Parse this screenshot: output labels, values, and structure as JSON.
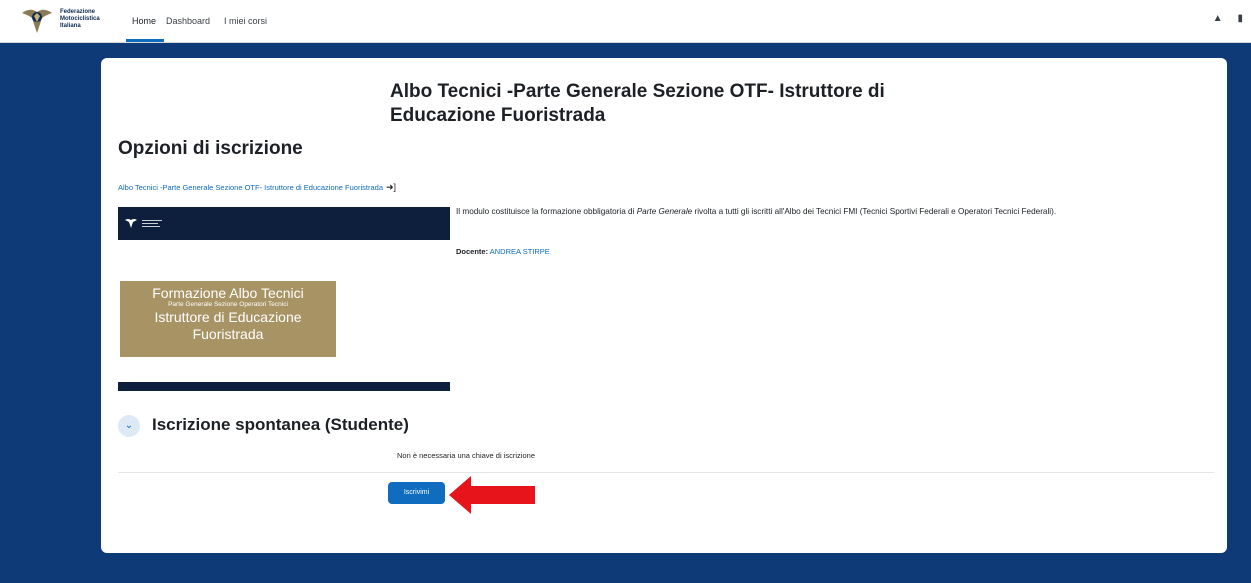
{
  "header": {
    "logo_text": [
      "Federazione",
      "Motociclistica",
      "Italiana"
    ],
    "nav": [
      {
        "label": "Home"
      },
      {
        "label": "Dashboard"
      },
      {
        "label": "I miei corsi"
      }
    ],
    "icons": [
      "bell-icon",
      "chat-icon"
    ]
  },
  "main": {
    "course_title_line1": "Albo Tecnici -Parte Generale Sezione OTF- Istruttore di",
    "course_title_line2": "Educazione Fuoristrada",
    "section_title": "Opzioni di iscrizione",
    "course_link": "Albo Tecnici -Parte Generale Sezione OTF- Istruttore di Educazione Fuoristrada",
    "summary_pre": "Il modulo costituisce la formazione obbligatoria di ",
    "summary_em": "Parte Generale",
    "summary_post": " rivolta a tutti gli iscritti all'Albo dei Tecnici FMI (Tecnici Sportivi Federali e Operatori Tecnici Federali).",
    "teacher_label": "Docente:",
    "teacher_name": "ANDREA STIRPE",
    "image": {
      "line1": "Formazione Albo Tecnici",
      "line2": "Parte Generale Sezione Operatori Tecnici",
      "line3": "Istruttore di Educazione",
      "line4": "Fuoristrada"
    },
    "enrol": {
      "title": "Iscrizione spontanea (Studente)",
      "no_key_text": "Non è necessaria una chiave di iscrizione",
      "button_label": "Iscrivimi"
    }
  },
  "colors": {
    "background": "#0f3a78",
    "primary": "#0f6cbf",
    "banner_dark": "#0d1f3c",
    "gold": "#a89364",
    "arrow": "#e8141b"
  }
}
